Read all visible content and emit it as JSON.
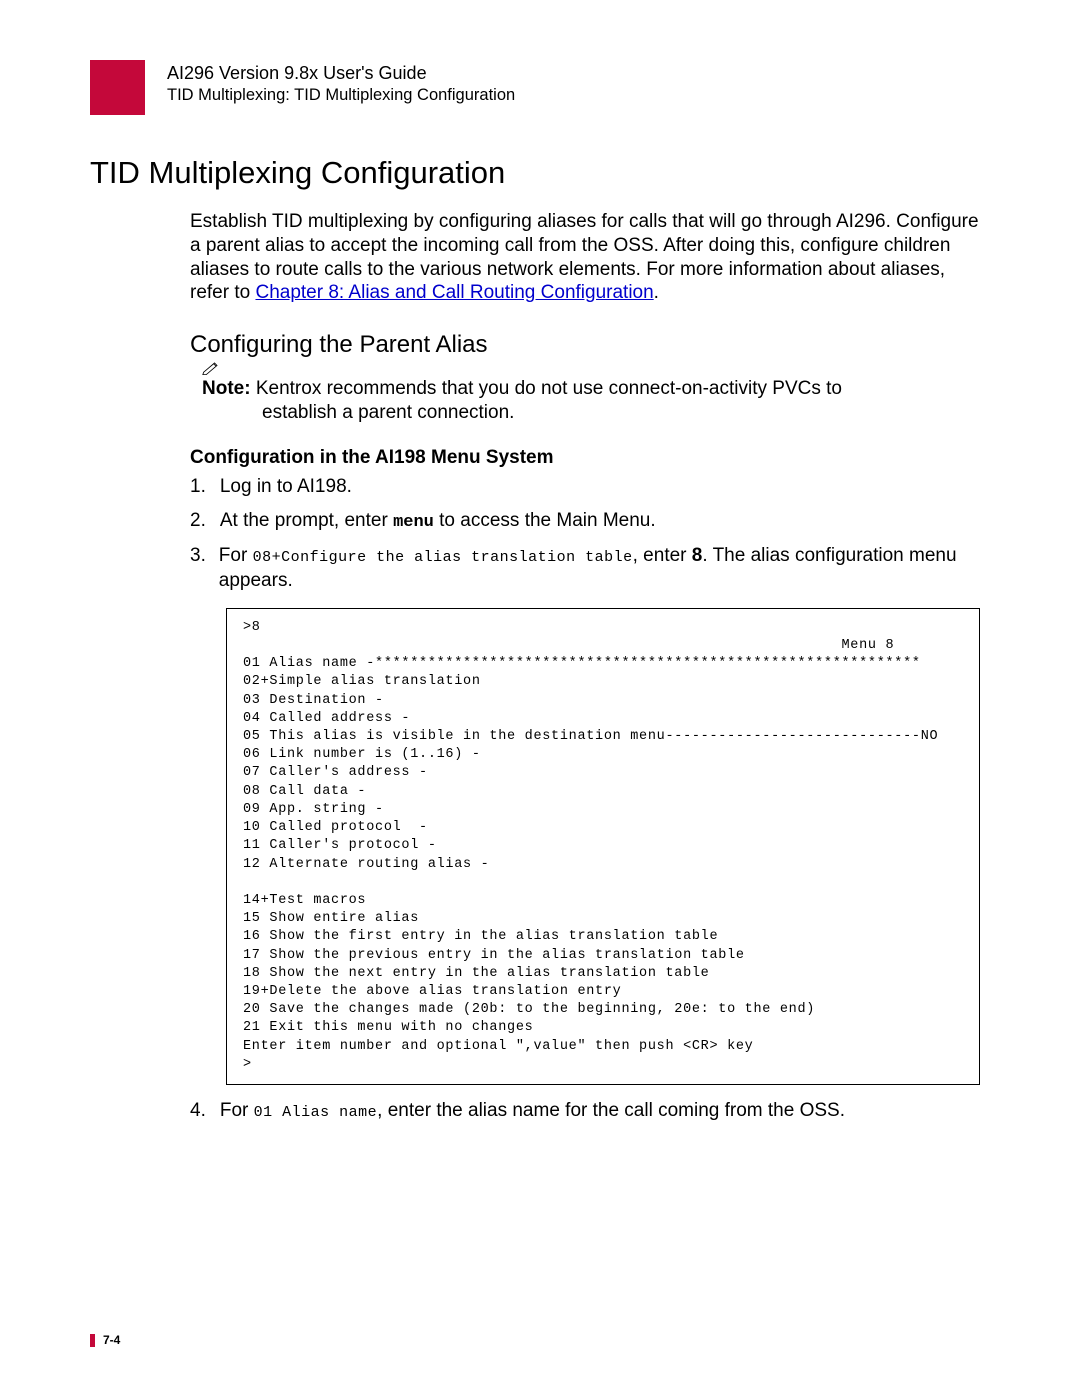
{
  "header": {
    "guide_title": "AI296 Version 9.8x User's Guide",
    "breadcrumb": "TID Multiplexing: TID Multiplexing Configuration"
  },
  "main_heading": "TID Multiplexing Configuration",
  "intro": {
    "text_before_link": "Establish TID multiplexing by configuring aliases for calls that will go through AI296. Configure a parent alias to accept the incoming call from the OSS. After doing this, configure children aliases to route calls to the various network elements. For more information about aliases, refer to ",
    "link_text": "Chapter 8:  Alias and Call Routing Configuration",
    "text_after_link": "."
  },
  "sub_heading": "Configuring the Parent Alias",
  "note": {
    "label": "Note:",
    "text_line1": "  Kentrox recommends that you do not use connect-on-activity PVCs to",
    "text_line2": "establish a parent connection."
  },
  "sub_sub_heading": "Configuration in the AI198 Menu System",
  "steps": {
    "s1": {
      "num": "1.",
      "text": "Log in to AI198."
    },
    "s2": {
      "num": "2.",
      "pre": "At the prompt, enter ",
      "cmd": "menu",
      "post": " to access the Main Menu."
    },
    "s3": {
      "num": "3.",
      "pre": "For ",
      "mono": "08+Configure the alias translation table",
      "mid": ", enter ",
      "bold": "8",
      "post": ". The alias configuration menu appears."
    },
    "s4": {
      "num": "4.",
      "pre": "For ",
      "mono": "01 Alias name",
      "post": ", enter the alias name for the call coming from the OSS."
    }
  },
  "code_block": ">8\n                                                                    Menu 8\n01 Alias name -**************************************************************\n02+Simple alias translation\n03 Destination -\n04 Called address -\n05 This alias is visible in the destination menu-----------------------------NO\n06 Link number is (1..16) -\n07 Caller's address -\n08 Call data -\n09 App. string -\n10 Called protocol  -\n11 Caller's protocol -\n12 Alternate routing alias -\n\n14+Test macros\n15 Show entire alias\n16 Show the first entry in the alias translation table\n17 Show the previous entry in the alias translation table\n18 Show the next entry in the alias translation table\n19+Delete the above alias translation entry\n20 Save the changes made (20b: to the beginning, 20e: to the end)\n21 Exit this menu with no changes\nEnter item number and optional \",value\" then push <CR> key\n>",
  "footer": {
    "page_number": "7-4"
  }
}
